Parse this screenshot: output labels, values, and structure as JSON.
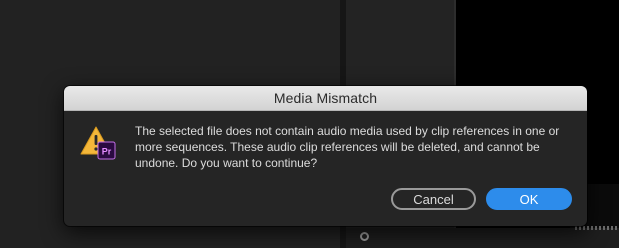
{
  "dialog": {
    "title": "Media Mismatch",
    "icon": "warning-premiere-pro-icon",
    "icon_badge": "Pr",
    "message": "The selected file does not contain audio media used by clip references in one or more sequences. These audio clip references will be deleted, and cannot be undone. Do you want to continue?",
    "cancel_label": "Cancel",
    "ok_label": "OK"
  },
  "colors": {
    "accent": "#2d8ceb",
    "warning": "#f4b73a",
    "premiere_purple": "#2a0a40",
    "premiere_text": "#e48cff"
  }
}
